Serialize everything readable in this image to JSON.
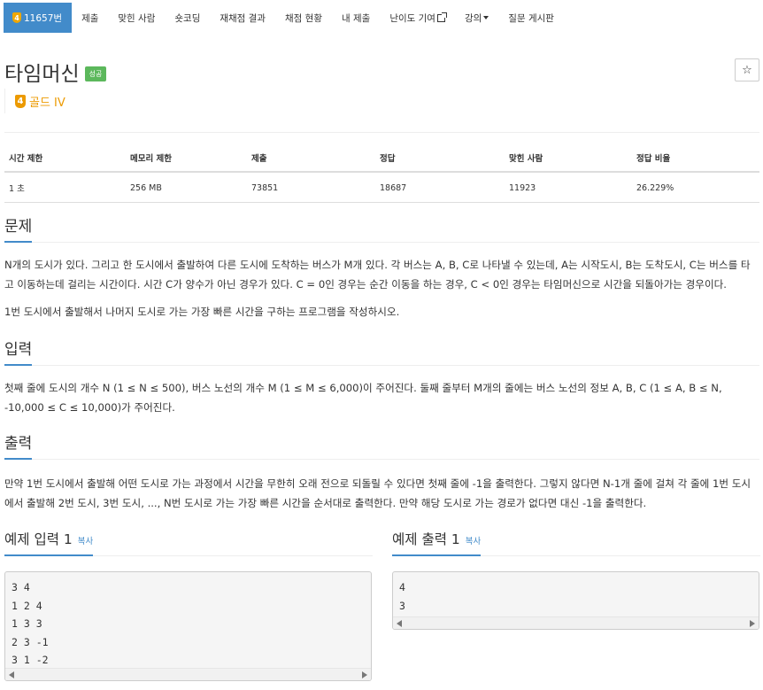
{
  "nav": {
    "problem_tier": "4",
    "problem_id": "11657번",
    "items": [
      "제출",
      "맞힌 사람",
      "숏코딩",
      "재채점 결과",
      "채점 현황",
      "내 제출",
      "난이도 기여",
      "강의",
      "질문 게시판"
    ]
  },
  "problem": {
    "title": "타임머신",
    "status_badge": "성공",
    "tier_number": "4",
    "tier_label": "골드 IV",
    "star": "☆"
  },
  "stats": {
    "headers": [
      "시간 제한",
      "메모리 제한",
      "제출",
      "정답",
      "맞힌 사람",
      "정답 비율"
    ],
    "values": [
      "1 초",
      "256 MB",
      "73851",
      "18687",
      "11923",
      "26.229%"
    ]
  },
  "sections": {
    "problem": {
      "title": "문제",
      "paragraphs": [
        "N개의 도시가 있다. 그리고 한 도시에서 출발하여 다른 도시에 도착하는 버스가 M개 있다. 각 버스는 A, B, C로 나타낼 수 있는데, A는 시작도시, B는 도착도시, C는 버스를 타고 이동하는데 걸리는 시간이다. 시간 C가 양수가 아닌 경우가 있다. C = 0인 경우는 순간 이동을 하는 경우, C < 0인 경우는 타임머신으로 시간을 되돌아가는 경우이다.",
        "1번 도시에서 출발해서 나머지 도시로 가는 가장 빠른 시간을 구하는 프로그램을 작성하시오."
      ]
    },
    "input": {
      "title": "입력",
      "paragraph": "첫째 줄에 도시의 개수 N (1 ≤ N ≤ 500), 버스 노선의 개수 M (1 ≤ M ≤ 6,000)이 주어진다. 둘째 줄부터 M개의 줄에는 버스 노선의 정보 A, B, C (1 ≤ A, B ≤ N, -10,000 ≤ C ≤ 10,000)가 주어진다."
    },
    "output": {
      "title": "출력",
      "paragraph": "만약 1번 도시에서 출발해 어떤 도시로 가는 과정에서 시간을 무한히 오래 전으로 되돌릴 수 있다면 첫째 줄에 -1을 출력한다. 그렇지 않다면 N-1개 줄에 걸쳐 각 줄에 1번 도시에서 출발해 2번 도시, 3번 도시, ..., N번 도시로 가는 가장 빠른 시간을 순서대로 출력한다. 만약 해당 도시로 가는 경로가 없다면 대신 -1을 출력한다."
    }
  },
  "examples": {
    "input": {
      "title": "예제 입력 1",
      "copy": "복사",
      "content": "3 4\n1 2 4\n1 3 3\n2 3 -1\n3 1 -2"
    },
    "output": {
      "title": "예제 출력 1",
      "copy": "복사",
      "content": "4\n3"
    }
  },
  "colors": {
    "primary": "#428bca",
    "success": "#5cb85c",
    "gold": "#ec9a00"
  }
}
